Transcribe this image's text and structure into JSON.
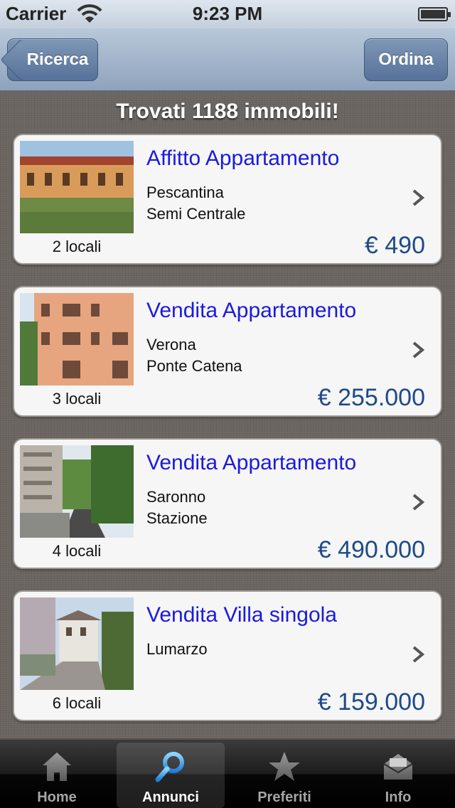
{
  "status_bar": {
    "carrier": "Carrier",
    "time": "9:23 PM"
  },
  "nav": {
    "back_label": "Ricerca",
    "order_label": "Ordina"
  },
  "result_title": "Trovati 1188 immobili!",
  "listings": [
    {
      "title": "Affitto Appartamento",
      "location": "Pescantina",
      "zone": "Semi Centrale",
      "rooms": "2 locali",
      "price": "€ 490"
    },
    {
      "title": "Vendita Appartamento",
      "location": "Verona",
      "zone": "Ponte Catena",
      "rooms": "3 locali",
      "price": "€ 255.000"
    },
    {
      "title": "Vendita Appartamento",
      "location": "Saronno",
      "zone": "Stazione",
      "rooms": "4 locali",
      "price": "€ 490.000"
    },
    {
      "title": "Vendita Villa singola",
      "location": "Lumarzo",
      "zone": "",
      "rooms": "6 locali",
      "price": "€ 159.000"
    }
  ],
  "tabs": [
    {
      "label": "Home",
      "icon": "home-icon"
    },
    {
      "label": "Annunci",
      "icon": "search-icon"
    },
    {
      "label": "Preferiti",
      "icon": "star-icon"
    },
    {
      "label": "Info",
      "icon": "mail-icon"
    }
  ],
  "active_tab": "Annunci",
  "colors": {
    "title_blue": "#1a1adf",
    "price_blue": "#1e4a88",
    "nav_button": "#56719a"
  }
}
